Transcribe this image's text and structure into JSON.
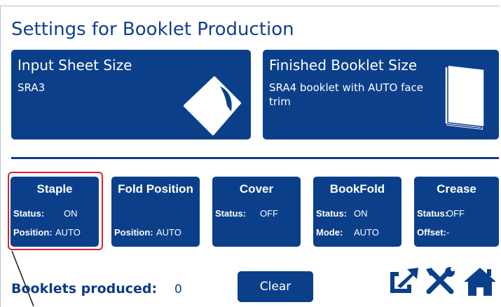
{
  "header": {
    "title": "Settings for Booklet Production"
  },
  "input_sheet": {
    "title": "Input Sheet Size",
    "value": "SRA3"
  },
  "finished_booklet": {
    "title": "Finished Booklet Size",
    "value": "SRA4 booklet with AUTO face trim"
  },
  "tiles": [
    {
      "title": "Staple",
      "rows": [
        {
          "key": "Status:",
          "value": "ON"
        },
        {
          "key": "Position:",
          "value": "AUTO"
        }
      ]
    },
    {
      "title": "Fold Position",
      "rows": [
        {
          "key": "Position:",
          "value": "AUTO"
        }
      ]
    },
    {
      "title": "Cover",
      "rows": [
        {
          "key": "Status:",
          "value": "OFF"
        }
      ]
    },
    {
      "title": "BookFold",
      "rows": [
        {
          "key": "Status:",
          "value": "ON"
        },
        {
          "key": "Mode:",
          "value": "AUTO"
        }
      ]
    },
    {
      "title": "Crease",
      "rows": [
        {
          "key": "Status:",
          "value": "OFF"
        },
        {
          "key": "Offset:",
          "value": "-"
        }
      ]
    }
  ],
  "footer": {
    "booklets_label": "Booklets produced:",
    "booklets_count": "0",
    "clear_label": "Clear"
  },
  "icons": [
    "export-icon",
    "tools-icon",
    "home-icon"
  ],
  "colors": {
    "primary": "#0b3f8a",
    "highlight": "#d9232d",
    "background": "#ffffff"
  }
}
